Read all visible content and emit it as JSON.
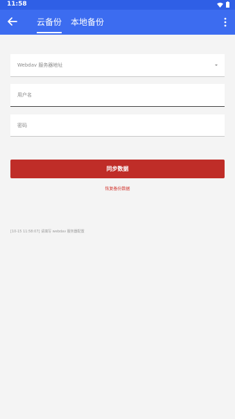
{
  "status_bar": {
    "time": "11:58",
    "icons": [
      "wifi-icon",
      "battery-icon"
    ]
  },
  "app_bar": {
    "back_icon": "arrow-left-icon",
    "tabs": [
      {
        "label": "云备份",
        "active": true
      },
      {
        "label": "本地备份",
        "active": false
      }
    ],
    "menu_icon": "more-vertical-icon",
    "color": "#3c6cf0"
  },
  "form": {
    "server_placeholder": "Webdav 服务器地址",
    "username_placeholder": "用户名",
    "password_placeholder": "密码"
  },
  "actions": {
    "sync_label": "同步数据",
    "sync_color": "#bf2d28",
    "restore_label": "恢复备份数据"
  },
  "log": {
    "text": "[10-15 11:58:07] 请填写 webdav 服务器配置"
  }
}
